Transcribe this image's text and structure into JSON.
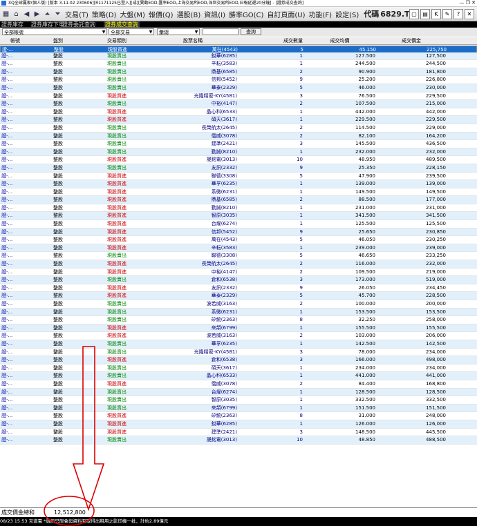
{
  "window": {
    "title": "XQ全球贏家(個人版) [版本 3.11.02 230606][R1171125已登入][成][異動EOD,匯率EOD,上海交易所EOD,深圳交易所EOD,日報延遲20分鐘] - [證券成交查詢]"
  },
  "menubar": {
    "items": [
      "交易(T)",
      "策略(D)",
      "大盤(M)",
      "報價(Q)",
      "選股(B)",
      "資訊(I)",
      "勝率GO(C)",
      "自訂頁面(U)",
      "功能(F)",
      "設定(S)"
    ],
    "code_label": "代碼",
    "code_value": "6829.TW"
  },
  "tabs": [
    "證券庫存",
    "證券庫存下單",
    "證券委託查詢",
    "證券成交查詢"
  ],
  "filters": {
    "account": "全部帳號",
    "type": "全部交易",
    "summary": "彙總",
    "query_button": "查詢"
  },
  "table": {
    "headers": [
      "帳號",
      "盤別",
      "交易類別",
      "股票名稱",
      "成交數量",
      "成交均價",
      "成交價金"
    ],
    "rows": [
      {
        "acct": "證-...",
        "cat": "整股",
        "type": "現股買進",
        "side": "buy",
        "name": "萬在(4543)",
        "qty": "5",
        "price": "45.150",
        "amt": "225,750"
      },
      {
        "acct": "證-...",
        "cat": "整股",
        "type": "現股賣出",
        "side": "sell",
        "name": "銳華(6285)",
        "qty": "1",
        "price": "127.500",
        "amt": "127,500"
      },
      {
        "acct": "證-...",
        "cat": "整股",
        "type": "現股賣出",
        "side": "sell",
        "name": "辛耘(3583)",
        "qty": "1",
        "price": "244.500",
        "amt": "244,500"
      },
      {
        "acct": "證-...",
        "cat": "整股",
        "type": "現股賣出",
        "side": "sell",
        "name": "鼎基(6585)",
        "qty": "2",
        "price": "90.900",
        "amt": "181,800"
      },
      {
        "acct": "證-...",
        "cat": "整股",
        "type": "現股賣出",
        "side": "sell",
        "name": "信邦(5452)",
        "qty": "9",
        "price": "25.200",
        "amt": "226,800"
      },
      {
        "acct": "證-...",
        "cat": "整股",
        "type": "現股賣出",
        "side": "sell",
        "name": "華泰(2329)",
        "qty": "5",
        "price": "46.000",
        "amt": "230,000"
      },
      {
        "acct": "證-...",
        "cat": "整股",
        "type": "現股買進",
        "side": "buy",
        "name": "光隆精密-KY(4581)",
        "qty": "3",
        "price": "76.500",
        "amt": "229,500"
      },
      {
        "acct": "證-...",
        "cat": "整股",
        "type": "現股賣出",
        "side": "sell",
        "name": "中裕(4147)",
        "qty": "2",
        "price": "107.500",
        "amt": "215,000"
      },
      {
        "acct": "證-...",
        "cat": "整股",
        "type": "現股買進",
        "side": "buy",
        "name": "晶心科(6533)",
        "qty": "1",
        "price": "442.000",
        "amt": "442,000"
      },
      {
        "acct": "證-...",
        "cat": "整股",
        "type": "現股買進",
        "side": "buy",
        "name": "碩天(3617)",
        "qty": "1",
        "price": "229.500",
        "amt": "229,500"
      },
      {
        "acct": "證-...",
        "cat": "整股",
        "type": "現股賣出",
        "side": "sell",
        "name": "長榮航太(2645)",
        "qty": "2",
        "price": "114.500",
        "amt": "229,000"
      },
      {
        "acct": "證-...",
        "cat": "整股",
        "type": "現股賣出",
        "side": "sell",
        "name": "僑威(3078)",
        "qty": "2",
        "price": "82.100",
        "amt": "164,200"
      },
      {
        "acct": "證-...",
        "cat": "整股",
        "type": "現股賣出",
        "side": "sell",
        "name": "建準(2421)",
        "qty": "3",
        "price": "145.500",
        "amt": "436,500"
      },
      {
        "acct": "證-...",
        "cat": "整股",
        "type": "現股賣出",
        "side": "sell",
        "name": "勤誠(8210)",
        "qty": "1",
        "price": "232.000",
        "amt": "232,000"
      },
      {
        "acct": "證-...",
        "cat": "整股",
        "type": "現股買進",
        "side": "buy",
        "name": "晟銘電(3013)",
        "qty": "10",
        "price": "48.950",
        "amt": "489,500"
      },
      {
        "acct": "證-...",
        "cat": "整股",
        "type": "現股賣出",
        "side": "sell",
        "name": "友訊(2332)",
        "qty": "9",
        "price": "25.350",
        "amt": "228,150"
      },
      {
        "acct": "證-...",
        "cat": "整股",
        "type": "現股買進",
        "side": "buy",
        "name": "聯德(3308)",
        "qty": "5",
        "price": "47.900",
        "amt": "239,500"
      },
      {
        "acct": "證-...",
        "cat": "整股",
        "type": "現股買進",
        "side": "buy",
        "name": "華孚(6235)",
        "qty": "1",
        "price": "139.000",
        "amt": "139,000"
      },
      {
        "acct": "證-...",
        "cat": "整股",
        "type": "現股買進",
        "side": "buy",
        "name": "系微(6231)",
        "qty": "1",
        "price": "149.500",
        "amt": "149,500"
      },
      {
        "acct": "證-...",
        "cat": "整股",
        "type": "現股買進",
        "side": "buy",
        "name": "鼎基(6585)",
        "qty": "2",
        "price": "88.500",
        "amt": "177,000"
      },
      {
        "acct": "證-...",
        "cat": "整股",
        "type": "現股買進",
        "side": "buy",
        "name": "勤誠(8210)",
        "qty": "1",
        "price": "231.000",
        "amt": "231,000"
      },
      {
        "acct": "證-...",
        "cat": "整股",
        "type": "現股買進",
        "side": "buy",
        "name": "智原(3035)",
        "qty": "1",
        "price": "341.500",
        "amt": "341,500"
      },
      {
        "acct": "證-...",
        "cat": "整股",
        "type": "現股買進",
        "side": "buy",
        "name": "台燿(6274)",
        "qty": "1",
        "price": "125.500",
        "amt": "125,500"
      },
      {
        "acct": "證-...",
        "cat": "整股",
        "type": "現股買進",
        "side": "buy",
        "name": "信邦(5452)",
        "qty": "9",
        "price": "25.650",
        "amt": "230,850"
      },
      {
        "acct": "證-...",
        "cat": "整股",
        "type": "現股買進",
        "side": "buy",
        "name": "萬在(4543)",
        "qty": "5",
        "price": "46.050",
        "amt": "230,250"
      },
      {
        "acct": "證-...",
        "cat": "整股",
        "type": "現股買進",
        "side": "buy",
        "name": "辛耘(3583)",
        "qty": "1",
        "price": "239.000",
        "amt": "239,000"
      },
      {
        "acct": "證-...",
        "cat": "整股",
        "type": "現股賣出",
        "side": "sell",
        "name": "聯德(3308)",
        "qty": "5",
        "price": "46.650",
        "amt": "233,250"
      },
      {
        "acct": "證-...",
        "cat": "整股",
        "type": "現股買進",
        "side": "buy",
        "name": "長榮航太(2645)",
        "qty": "2",
        "price": "116.000",
        "amt": "232,000"
      },
      {
        "acct": "證-...",
        "cat": "整股",
        "type": "現股買進",
        "side": "buy",
        "name": "中裕(4147)",
        "qty": "2",
        "price": "109.500",
        "amt": "219,000"
      },
      {
        "acct": "證-...",
        "cat": "整股",
        "type": "現股賣出",
        "side": "sell",
        "name": "倉和(6538)",
        "qty": "3",
        "price": "173.000",
        "amt": "519,000"
      },
      {
        "acct": "證-...",
        "cat": "整股",
        "type": "現股買進",
        "side": "buy",
        "name": "友訊(2332)",
        "qty": "9",
        "price": "26.050",
        "amt": "234,450"
      },
      {
        "acct": "證-...",
        "cat": "整股",
        "type": "現股買進",
        "side": "buy",
        "name": "華泰(2329)",
        "qty": "5",
        "price": "45.700",
        "amt": "228,500"
      },
      {
        "acct": "證-...",
        "cat": "整股",
        "type": "現股賣出",
        "side": "sell",
        "name": "波若威(3163)",
        "qty": "2",
        "price": "100.000",
        "amt": "200,000"
      },
      {
        "acct": "證-...",
        "cat": "整股",
        "type": "現股賣出",
        "side": "sell",
        "name": "系微(6231)",
        "qty": "1",
        "price": "153.500",
        "amt": "153,500"
      },
      {
        "acct": "證-...",
        "cat": "整股",
        "type": "現股賣出",
        "side": "sell",
        "name": "矽統(2363)",
        "qty": "8",
        "price": "32.250",
        "amt": "258,000"
      },
      {
        "acct": "證-...",
        "cat": "整股",
        "type": "現股買進",
        "side": "buy",
        "name": "來頡(6799)",
        "qty": "1",
        "price": "155.500",
        "amt": "155,500"
      },
      {
        "acct": "證-...",
        "cat": "整股",
        "type": "現股買進",
        "side": "buy",
        "name": "波若威(3163)",
        "qty": "2",
        "price": "103.000",
        "amt": "206,000"
      },
      {
        "acct": "證-...",
        "cat": "整股",
        "type": "現股賣出",
        "side": "sell",
        "name": "華孚(6235)",
        "qty": "1",
        "price": "142.500",
        "amt": "142,500"
      },
      {
        "acct": "證-...",
        "cat": "整股",
        "type": "現股賣出",
        "side": "sell",
        "name": "光隆精密-KY(4581)",
        "qty": "3",
        "price": "78.000",
        "amt": "234,000"
      },
      {
        "acct": "證-...",
        "cat": "整股",
        "type": "現股買進",
        "side": "buy",
        "name": "倉和(6538)",
        "qty": "3",
        "price": "166.000",
        "amt": "498,000"
      },
      {
        "acct": "證-...",
        "cat": "整股",
        "type": "現股賣出",
        "side": "sell",
        "name": "碩天(3617)",
        "qty": "1",
        "price": "234.000",
        "amt": "234,000"
      },
      {
        "acct": "證-...",
        "cat": "整股",
        "type": "現股賣出",
        "side": "sell",
        "name": "晶心科(6533)",
        "qty": "1",
        "price": "441.000",
        "amt": "441,000"
      },
      {
        "acct": "證-...",
        "cat": "整股",
        "type": "現股買進",
        "side": "buy",
        "name": "僑威(3078)",
        "qty": "2",
        "price": "84.400",
        "amt": "168,800"
      },
      {
        "acct": "證-...",
        "cat": "整股",
        "type": "現股賣出",
        "side": "sell",
        "name": "台燿(6274)",
        "qty": "1",
        "price": "128.500",
        "amt": "128,500"
      },
      {
        "acct": "證-...",
        "cat": "整股",
        "type": "現股賣出",
        "side": "sell",
        "name": "智原(3035)",
        "qty": "1",
        "price": "332.500",
        "amt": "332,500"
      },
      {
        "acct": "證-...",
        "cat": "整股",
        "type": "現股賣出",
        "side": "sell",
        "name": "來頡(6799)",
        "qty": "1",
        "price": "151.500",
        "amt": "151,500"
      },
      {
        "acct": "證-...",
        "cat": "整股",
        "type": "現股買進",
        "side": "buy",
        "name": "矽統(2363)",
        "qty": "8",
        "price": "31.000",
        "amt": "248,000"
      },
      {
        "acct": "證-...",
        "cat": "整股",
        "type": "現股買進",
        "side": "buy",
        "name": "銳華(6285)",
        "qty": "1",
        "price": "126.000",
        "amt": "126,000"
      },
      {
        "acct": "證-...",
        "cat": "整股",
        "type": "現股買進",
        "side": "buy",
        "name": "建準(2421)",
        "qty": "3",
        "price": "148.500",
        "amt": "445,500"
      },
      {
        "acct": "證-...",
        "cat": "整股",
        "type": "現股賣出",
        "side": "sell",
        "name": "晟銘電(3013)",
        "qty": "10",
        "price": "48.850",
        "amt": "488,500"
      }
    ]
  },
  "summary": {
    "label": "成交價金總和",
    "value": "12,512,800"
  },
  "status": {
    "time": "08/23 15:53",
    "text": "互道電 *融訊只限會與資料有取得出租用之影印機一批，計約2.89億元"
  },
  "colors": {
    "buy": "#cc0000",
    "sell": "#008800",
    "selected_row": "#1c6cc8",
    "odd_row": "#e2f0fb",
    "annotation": "#dd0000"
  }
}
